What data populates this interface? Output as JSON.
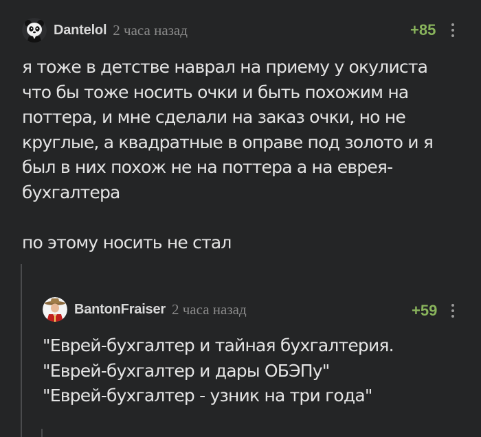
{
  "comment": {
    "author": "Dantelol",
    "time": "2 часа назад",
    "rating": "+85",
    "lines": [
      "я тоже в детстве наврал на приему у окулиста",
      "что бы тоже носить очки и быть похожим на",
      "поттера,  и мне сделали на заказ очки, но не",
      "круглые, а квадратные в оправе под золото и я",
      "был в них похож не на поттера а на еврея-",
      "бухгалтера",
      "",
      "по этому носить не стал"
    ],
    "avatar_icon": "panda-avatar-icon"
  },
  "reply": {
    "author": "BantonFraiser",
    "time": "2 часа назад",
    "rating": "+59",
    "lines": [
      "\"Еврей-бухгалтер и тайная бухгалтерия.",
      "\"Еврей-бухгалтер и дары ОБЭПу\"",
      "\"Еврей-бухгалтер - узник на три года\""
    ],
    "avatar_icon": "mountie-avatar-icon"
  },
  "colors": {
    "background": "#242526",
    "rating": "#89b45c",
    "text": "#e4e4e4",
    "muted": "#8a8a8a"
  }
}
